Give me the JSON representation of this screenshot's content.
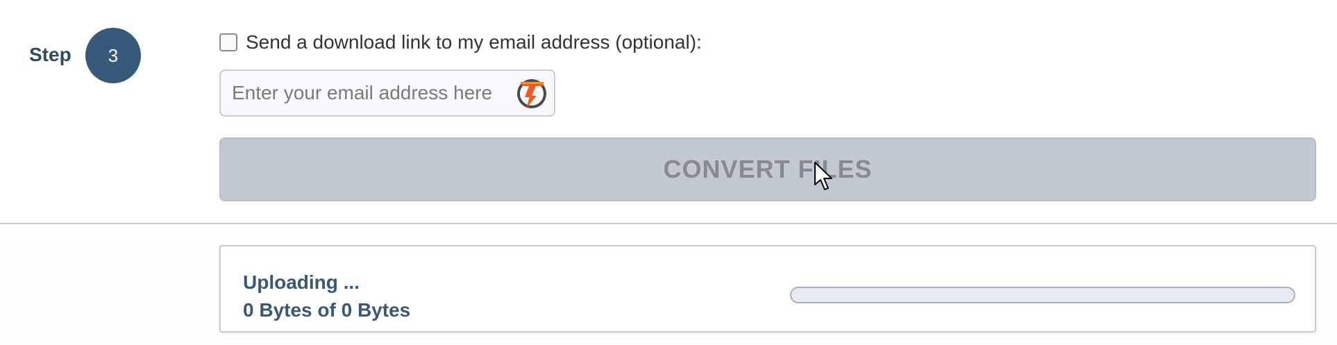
{
  "step": {
    "label": "Step",
    "number": "3"
  },
  "email_option": {
    "checkbox_label": "Send a download link to my email address (optional):",
    "checked": false,
    "input_placeholder": "Enter your email address here",
    "input_value": "",
    "logo_icon": "lightning-t-logo-icon"
  },
  "convert_button": {
    "label": "CONVERT FILES",
    "state": "disabled"
  },
  "upload": {
    "status": "Uploading ...",
    "bytes_text": "0 Bytes of 0 Bytes",
    "progress": 0
  },
  "colors": {
    "accent": "#375a7a",
    "button_disabled_bg": "#c3c9d0",
    "button_disabled_text": "#868b91",
    "status_text": "#3a5875"
  }
}
